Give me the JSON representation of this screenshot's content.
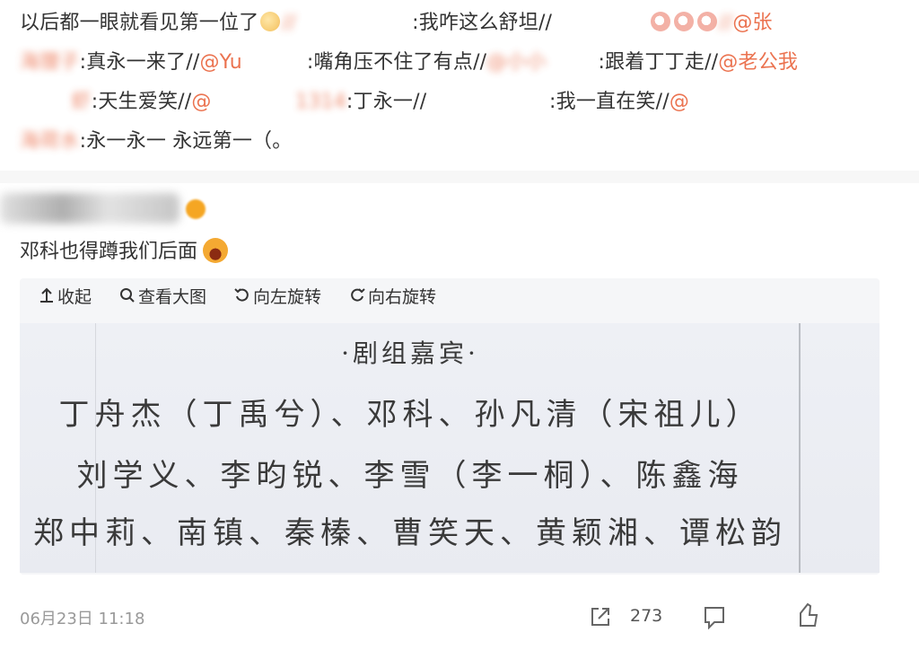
{
  "comment": {
    "line1_a": "以后都一眼就看见第一位了",
    "line1_b": "//",
    "line1_c": ":我咋这么舒坦//",
    "line1_d": "@张",
    "line2_a": "海狸子",
    "line2_b": ":真永一来了//",
    "line2_c": "@Yu",
    "line2_d": ":嘴角压不住了有点//",
    "line2_e": "@小小",
    "line2_f": ":跟着丁丁走//",
    "line2_g": "@老公我",
    "line3_a": "虾",
    "line3_b": ":天生爱笑//",
    "line3_c": "@",
    "line3_d": "1314",
    "line3_e": ":丁永一//",
    "line3_f": ":我一直在笑//",
    "line3_g": "@",
    "line4_a": "海荷水",
    "line4_b": ":永一永一 永远第一（。"
  },
  "reply": {
    "text": "邓科也得蹲我们后面"
  },
  "toolbar": {
    "collapse": "收起",
    "view_large": "查看大图",
    "rotate_left": "向左旋转",
    "rotate_right": "向右旋转"
  },
  "image": {
    "title": "·剧组嘉宾·",
    "line1": "丁舟杰（丁禹兮）、邓科、孙凡清（宋祖儿）",
    "line2": "刘学义、李昀锐、李雪（李一桐）、陈鑫海",
    "line3": "郑中莉、南镇、秦榛、曹笑天、黄颖湘、谭松韵"
  },
  "footer": {
    "timestamp": "06月23日 11:18",
    "share_count": "273"
  }
}
